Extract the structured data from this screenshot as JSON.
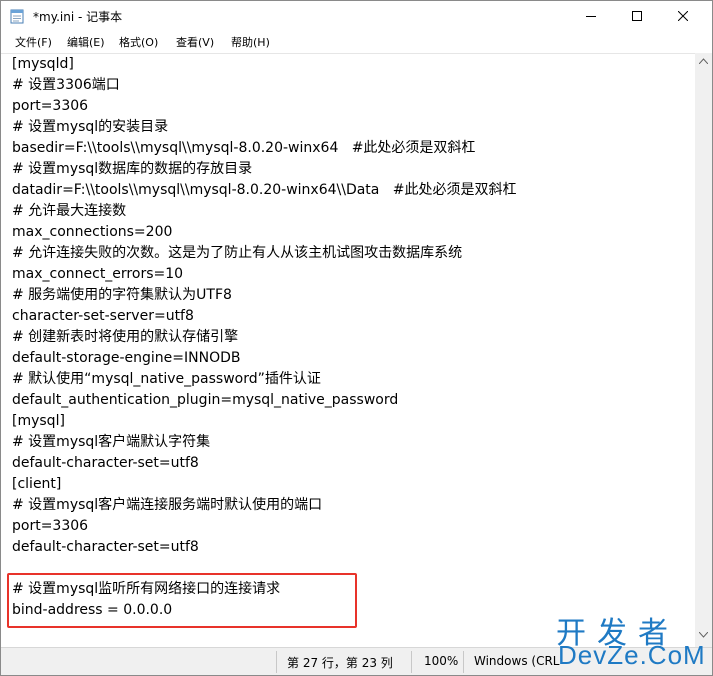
{
  "window": {
    "title": "*my.ini - 记事本",
    "menu": [
      "文件(F)",
      "编辑(E)",
      "格式(O)",
      "查看(V)",
      "帮助(H)"
    ]
  },
  "editor": {
    "lines": [
      "[mysqld]",
      "# 设置3306端口",
      "port=3306",
      "# 设置mysql的安装目录",
      "basedir=F:\\\\tools\\\\mysql\\\\mysql-8.0.20-winx64   #此处必须是双斜杠",
      "# 设置mysql数据库的数据的存放目录",
      "datadir=F:\\\\tools\\\\mysql\\\\mysql-8.0.20-winx64\\\\Data   #此处必须是双斜杠",
      "# 允许最大连接数",
      "max_connections=200",
      "# 允许连接失败的次数。这是为了防止有人从该主机试图攻击数据库系统",
      "max_connect_errors=10",
      "# 服务端使用的字符集默认为UTF8",
      "character-set-server=utf8",
      "# 创建新表时将使用的默认存储引擎",
      "default-storage-engine=INNODB",
      "# 默认使用“mysql_native_password”插件认证",
      "default_authentication_plugin=mysql_native_password",
      "[mysql]",
      "# 设置mysql客户端默认字符集",
      "default-character-set=utf8",
      "[client]",
      "# 设置mysql客户端连接服务端时默认使用的端口",
      "port=3306",
      "default-character-set=utf8",
      "",
      "# 设置mysql监听所有网络接口的连接请求",
      "bind-address = 0.0.0.0"
    ]
  },
  "status": {
    "position": "第 27 行，第 23 列",
    "zoom": "100%",
    "line_ending": "Windows (CRL"
  },
  "watermark": {
    "cn": "开发者",
    "en": "DevZe.CoM"
  },
  "colors": {
    "highlight": "#e8332a",
    "watermark": "#1f7ac4"
  }
}
